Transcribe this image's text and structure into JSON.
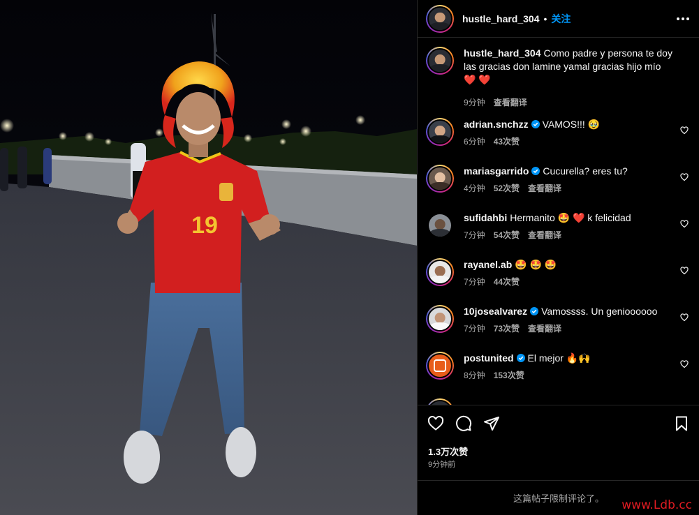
{
  "post": {
    "username": "hustle_hard_304",
    "separator": "•",
    "follow_label": "关注",
    "caption": {
      "username": "hustle_hard_304",
      "text": "Como padre y persona te doy las gracias don lamine yamal gracias hijo mío ❤️ ❤️",
      "time": "9分钟",
      "translate": "查看翻译"
    },
    "photo": {
      "jersey_number": "19",
      "jersey_color": "#d21f1f",
      "wig_colors": [
        "#f4c430",
        "#e23a1b"
      ]
    },
    "comments": [
      {
        "username": "adrian.snchzz",
        "verified": true,
        "text": "VAMOS!!!",
        "emoji": "🥹",
        "time": "6分钟",
        "likes": "43次赞",
        "translate": ""
      },
      {
        "username": "mariasgarrido",
        "verified": true,
        "text": "Cucurella? eres tu?",
        "emoji": "",
        "time": "4分钟",
        "likes": "52次赞",
        "translate": "查看翻译"
      },
      {
        "username": "sufidahbi",
        "verified": false,
        "text": "Hermanito 🤩 ❤️ k felicidad",
        "emoji": "",
        "time": "7分钟",
        "likes": "54次赞",
        "translate": "查看翻译"
      },
      {
        "username": "rayanel.ab",
        "verified": false,
        "text": "🤩 🤩 🤩",
        "emoji": "",
        "time": "7分钟",
        "likes": "44次赞",
        "translate": ""
      },
      {
        "username": "10josealvarez",
        "verified": true,
        "text": "Vamossss. Un genioooooo",
        "emoji": "",
        "time": "7分钟",
        "likes": "73次赞",
        "translate": "查看翻译"
      },
      {
        "username": "postunited",
        "verified": true,
        "text": "El mejor 🔥🙌",
        "emoji": "",
        "time": "8分钟",
        "likes": "153次赞",
        "translate": ""
      }
    ],
    "likes_count": "1.3万次赞",
    "posted_ago": "9分钟前",
    "comments_limited": "这篇帖子限制评论了。"
  },
  "watermark": "www.Ldb.cc",
  "colors": {
    "accent": "#0095f6",
    "heart": "#ed4956",
    "muted": "#a8a8a8",
    "border": "#262626"
  },
  "icons": [
    "more-options-icon",
    "heart-icon",
    "comment-icon",
    "share-icon",
    "bookmark-icon",
    "verified-badge-icon",
    "small-heart-icon"
  ]
}
